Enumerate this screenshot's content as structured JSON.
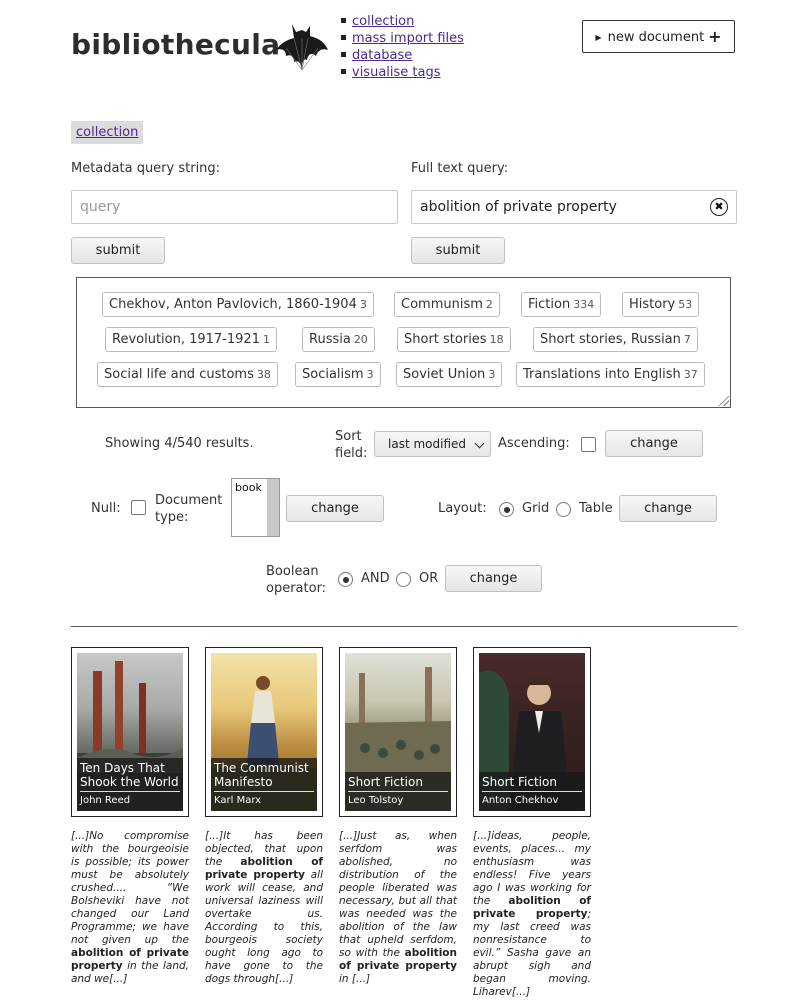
{
  "header": {
    "title": "bibliothecula",
    "nav": [
      "collection",
      "mass import files",
      "database",
      "visualise tags"
    ],
    "new_document_label": "new document"
  },
  "breadcrumb": "collection",
  "metadata_query": {
    "label": "Metadata query string:",
    "placeholder": "query",
    "value": "",
    "submit_label": "submit"
  },
  "fulltext_query": {
    "label": "Full text query:",
    "value": "abolition of private property",
    "submit_label": "submit"
  },
  "tags": [
    {
      "name": "Chekhov, Anton Pavlovich, 1860-1904",
      "count": "3"
    },
    {
      "name": "Communism",
      "count": "2"
    },
    {
      "name": "Fiction",
      "count": "334"
    },
    {
      "name": "History",
      "count": "53"
    },
    {
      "name": "Revolution, 1917-1921",
      "count": "1"
    },
    {
      "name": "Russia",
      "count": "20"
    },
    {
      "name": "Short stories",
      "count": "18"
    },
    {
      "name": "Short stories, Russian",
      "count": "7"
    },
    {
      "name": "Social life and customs",
      "count": "38"
    },
    {
      "name": "Socialism",
      "count": "3"
    },
    {
      "name": "Soviet Union",
      "count": "3"
    },
    {
      "name": "Translations into English",
      "count": "37"
    }
  ],
  "controls": {
    "results_text": "Showing 4/540 results.",
    "sort_label_1": "Sort",
    "sort_label_2": "field:",
    "sort_value": "last modified",
    "ascending_label": "Ascending:",
    "change_label": "change",
    "null_label": "Null:",
    "doctype_label_1": "Document",
    "doctype_label_2": "type:",
    "doctype_option": "book",
    "layout_label": "Layout:",
    "layout_grid": "Grid",
    "layout_table": "Table",
    "boolean_label_1": "Boolean",
    "boolean_label_2": "operator:",
    "and_label": "AND",
    "or_label": "OR"
  },
  "documents": [
    {
      "title": "Ten Days That Shook the World",
      "author": "John Reed"
    },
    {
      "title": "The Communist Manifesto",
      "author": "Karl Marx"
    },
    {
      "title": "Short Fiction",
      "author": "Leo Tolstoy"
    },
    {
      "title": "Short Fiction",
      "author": "Anton Chekhov"
    }
  ],
  "snippets": [
    {
      "before": "[...]No compromise with the bourgeoisie is possible; its power must be absolutely crushed.... “We Bolsheviki have not changed our Land Programme; we have not given up the ",
      "match": "abolition of private property",
      "after": " in the land, and we[...]"
    },
    {
      "before": "[...]It has been objected, that upon the ",
      "match": "abolition of private property",
      "after": " all work will cease, and universal laziness will overtake us. According to this, bourgeois society ought long ago to have gone to the dogs through[...]"
    },
    {
      "before": "[...]Just as, when serfdom was abolished, no distribution of the people liberated was necessary, but all that was needed was the abolition of the law that upheld serfdom, so with the ",
      "match": "abolition of private property",
      "after": " in [...]"
    },
    {
      "before": "[...]ideas, people, events, places... my enthusiasm was endless! Five years ago I was working for the ",
      "match": "abolition of private property",
      "after": "; my last creed was nonresistance to evil.” Sasha gave an abrupt sigh and began moving. Liharev[...]"
    }
  ]
}
